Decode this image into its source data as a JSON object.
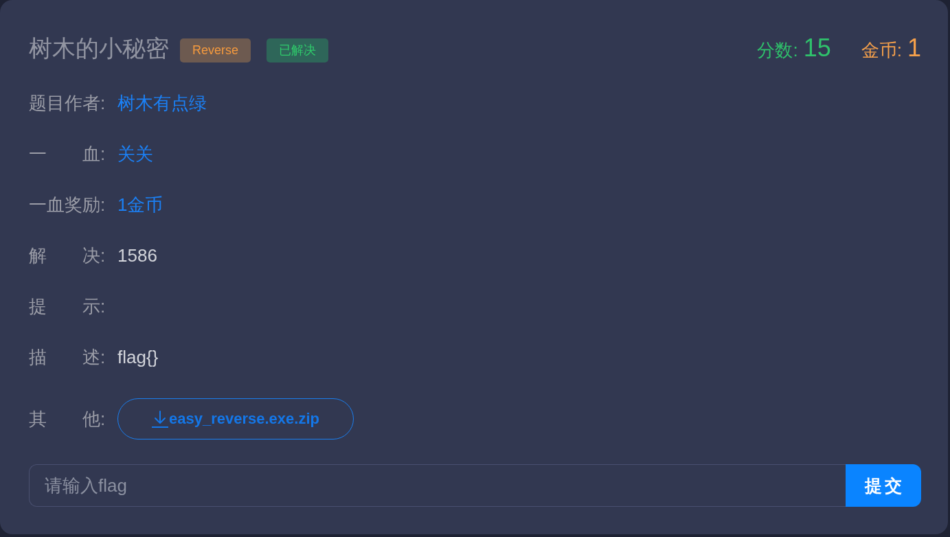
{
  "challenge": {
    "title": "树木的小秘密",
    "tags": [
      {
        "label": "Reverse",
        "kind": "category"
      },
      {
        "label": "已解决",
        "kind": "status"
      }
    ]
  },
  "stats": [
    {
      "kind": "score",
      "label": "分数:",
      "value": "15"
    },
    {
      "kind": "coins",
      "label": "金币:",
      "value": "1"
    }
  ],
  "fields": [
    {
      "label": "题目作者:",
      "kind": "link",
      "value": "树木有点绿"
    },
    {
      "label": "一　　血:",
      "kind": "link",
      "value": "关关"
    },
    {
      "label": "一血奖励:",
      "kind": "link",
      "value": "1金币"
    },
    {
      "label": "解　　决:",
      "kind": "text",
      "value": "1586"
    },
    {
      "label": "提　　示:",
      "kind": "text"
    },
    {
      "label": "描　　述:",
      "kind": "text",
      "value": "flag{}"
    },
    {
      "label": "其　　他:",
      "kind": "attachment",
      "value": "easy_reverse.exe.zip"
    }
  ],
  "flag_input": {
    "placeholder": "请输入flag"
  },
  "submit_button": {
    "label": "提交"
  }
}
